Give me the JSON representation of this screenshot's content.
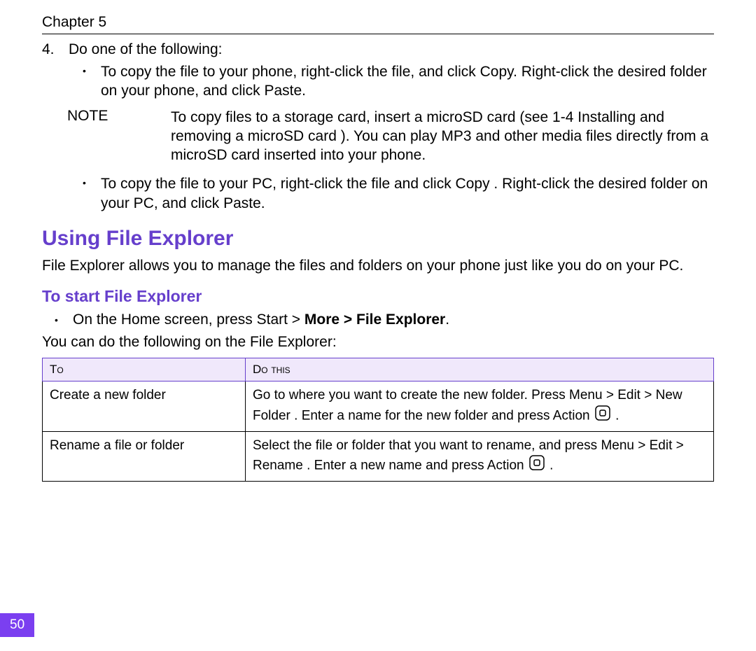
{
  "header": {
    "chapter": "Chapter 5"
  },
  "step": {
    "num": "4.",
    "text": "Do one of the following:"
  },
  "bullets": {
    "b1": "To copy the file to your phone, right-click the file, and click Copy.  Right-click the desired folder on your phone, and click Paste.",
    "b2": "To copy the file to your PC, right-click the file and click Copy . Right-click the desired folder on your PC, and click Paste."
  },
  "note": {
    "label": "NOTE",
    "text": "To copy files to a storage card, insert a microSD card (see 1-4 Installing and removing a microSD card  ). You can play MP3 and other media files directly from a microSD card inserted into your phone."
  },
  "h2": "Using File Explorer",
  "fe_para": "File Explorer allows you to manage the files and folders on your phone just like you do on your PC.",
  "h3": "To start File Explorer",
  "instr": {
    "pre": "On the Home screen, press Start  > ",
    "bold": "More > File Explorer",
    "post": "."
  },
  "after": "You can do the following on the File Explorer:",
  "table": {
    "head": {
      "c1": "To",
      "c2": "Do this"
    },
    "rows": [
      {
        "c1": "Create a new folder",
        "c2a": "Go to where you want to create the new folder. Press Menu > Edit > New Folder . Enter a name for the new folder and press Action ",
        "c2b": " ."
      },
      {
        "c1": "Rename a file or folder",
        "c2a": "Select the file or folder that you want to rename, and press Menu > Edit > Rename . Enter a new name and press Action ",
        "c2b": " ."
      }
    ]
  },
  "pagenum": "50"
}
